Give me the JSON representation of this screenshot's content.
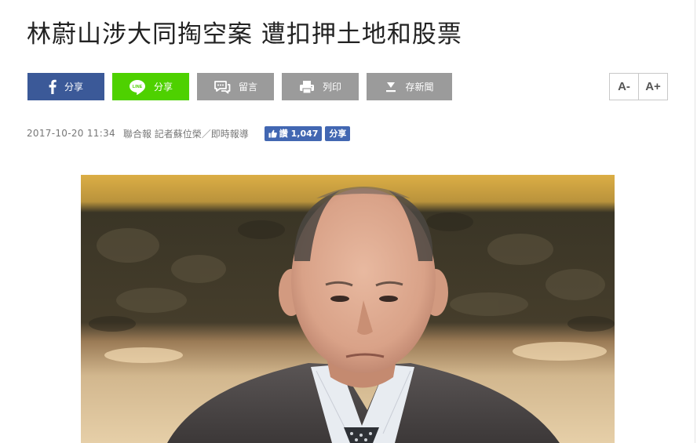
{
  "article": {
    "title": "林蔚山涉大同掏空案 遭扣押土地和股票",
    "date": "2017-10-20 11:34",
    "byline": "聯合報 記者蘇位榮／即時報導"
  },
  "share_bar": {
    "facebook_label": "分享",
    "line_label": "分享",
    "line_icon_text": "LINE",
    "comment_label": "留言",
    "print_label": "列印",
    "save_label": "存新聞"
  },
  "font_size": {
    "decrease_label": "A-",
    "increase_label": "A+"
  },
  "social": {
    "like_label": "讚",
    "like_count": "1,047",
    "share_label": "分享"
  },
  "colors": {
    "facebook": "#3b5998",
    "line": "#4ed100",
    "gray_button": "#9b9b9b",
    "fb_widget": "#4267b2"
  },
  "icons": [
    "facebook-icon",
    "line-icon",
    "comment-icon",
    "print-icon",
    "download-icon",
    "thumbs-up-icon"
  ]
}
